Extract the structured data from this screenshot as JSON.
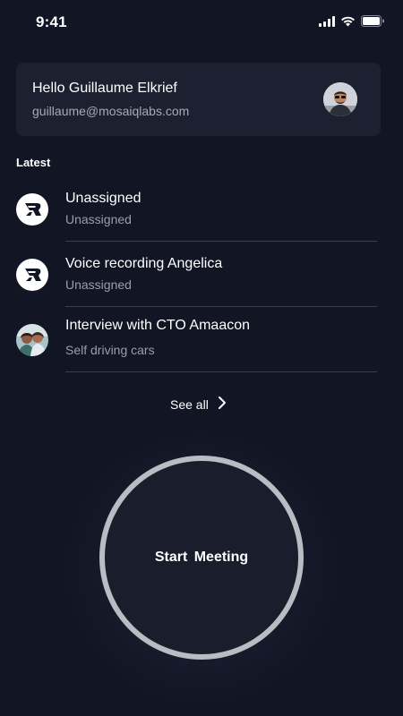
{
  "status_bar": {
    "time": "9:41"
  },
  "profile": {
    "greeting": "Hello Guillaume Elkrief",
    "email": "guillaume@mosaiqlabs.com",
    "avatar_icon": "user-avatar"
  },
  "latest": {
    "label": "Latest",
    "items": [
      {
        "title": "Unassigned",
        "subtitle": "Unassigned",
        "icon": "app-logo-icon"
      },
      {
        "title": "Voice recording Angelica",
        "subtitle": "Unassigned",
        "icon": "app-logo-icon"
      },
      {
        "title": "Interview with CTO Amaacon",
        "subtitle": "Self driving cars",
        "icon": "photo-avatar-icon"
      }
    ],
    "see_all": "See all"
  },
  "start_button": {
    "label": "Start Meeting"
  },
  "colors": {
    "background": "#111524",
    "card": "#1c2030",
    "ring": "#b9bcc3",
    "muted_text": "#9a9fab"
  }
}
